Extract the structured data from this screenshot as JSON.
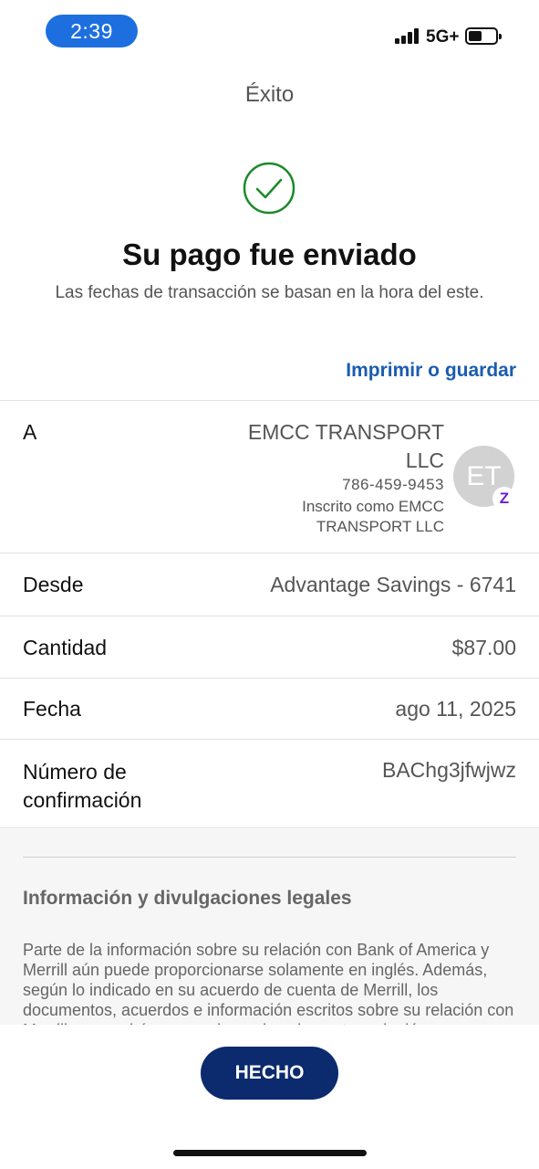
{
  "status_bar": {
    "time": "2:39",
    "network": "5G+",
    "icons": [
      "cellular-signal-icon",
      "battery-icon"
    ]
  },
  "header": {
    "title": "Éxito"
  },
  "confirmation": {
    "icon": "checkmark-circle-icon",
    "headline": "Su pago fue enviado",
    "subtext": "Las fechas de transacción se basan en la hora del este."
  },
  "print_link": "Imprimir o guardar",
  "details": {
    "to": {
      "label": "A",
      "name": "EMCC TRANSPORT LLC",
      "phone": "786-459-9453",
      "enrolled": "Inscrito como EMCC TRANSPORT LLC",
      "avatar_initials": "ET",
      "badge": "Z"
    },
    "from": {
      "label": "Desde",
      "value": "Advantage Savings - 6741"
    },
    "amount": {
      "label": "Cantidad",
      "value": "$87.00"
    },
    "date": {
      "label": "Fecha",
      "value": "ago 11, 2025"
    },
    "confirmation": {
      "label": "Número de confirmación",
      "value": "BAChg3jfwjwz"
    }
  },
  "legal": {
    "title": "Información y divulgaciones legales",
    "body": "Parte de la información sobre su relación con Bank of America y Merrill aún puede proporcionarse solamente en inglés. Además, según lo indicado en su acuerdo de cuenta de Merrill, los documentos, acuerdos e información escritos sobre su relación con Merrill se seguirán proporcionando solamente en inglés."
  },
  "done_button": "HECHO",
  "colors": {
    "accent": "#1a5cb0",
    "button": "#0b2b6e",
    "success": "#1b8a2a",
    "zelle": "#6d1ed4"
  }
}
